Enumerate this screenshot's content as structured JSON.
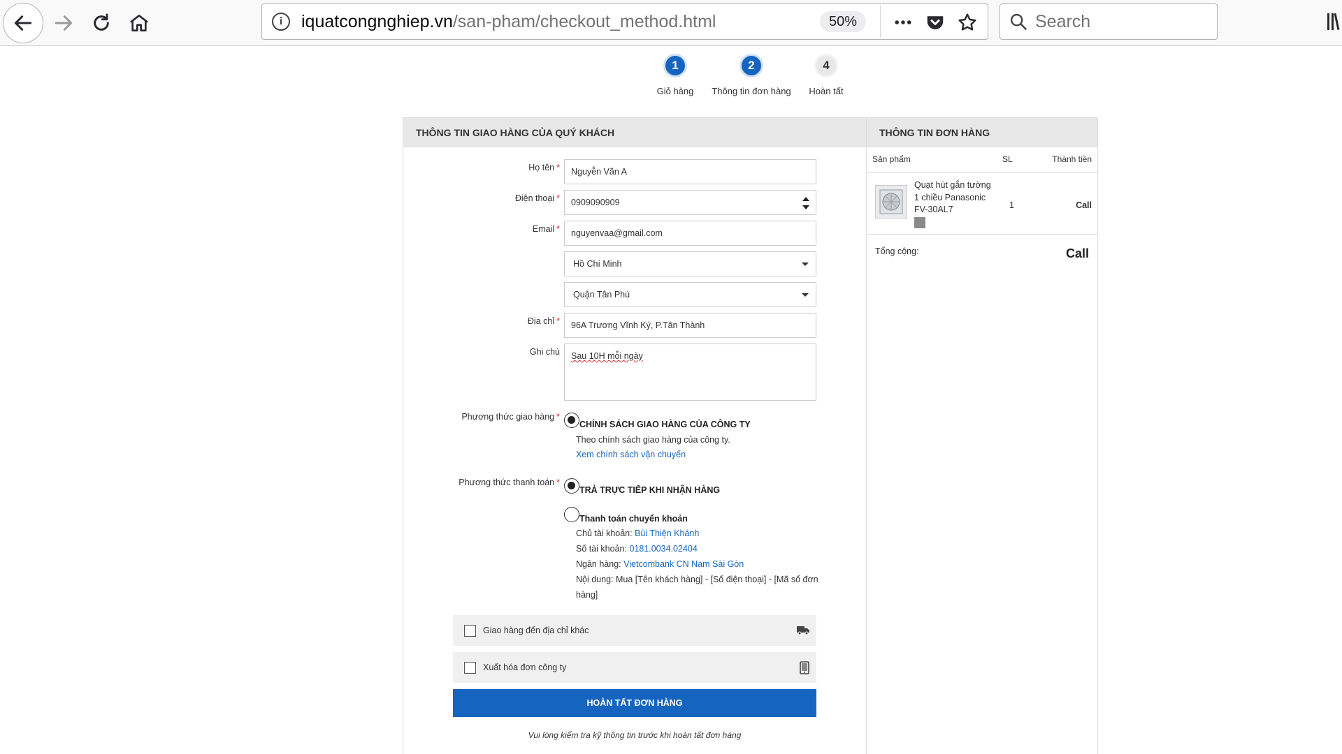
{
  "browser": {
    "url_domain": "iquatcongnghiep.vn",
    "url_path": "/san-pham/checkout_method.html",
    "zoom": "50%",
    "search_placeholder": "Search",
    "icons": [
      "back-arrow-icon",
      "forward-arrow-icon",
      "reload-icon",
      "home-icon",
      "info-icon",
      "more-icon",
      "pocket-icon",
      "star-icon",
      "search-icon",
      "library-icon"
    ]
  },
  "steps": [
    {
      "number": "1",
      "label": "Giỏ hàng",
      "active": true
    },
    {
      "number": "2",
      "label": "Thông tin đơn hàng",
      "active": true
    },
    {
      "number": "4",
      "label": "Hoàn tất",
      "active": false
    }
  ],
  "shipping": {
    "heading": "THÔNG TIN GIAO HÀNG CỦA QUÝ KHÁCH",
    "required_mark": "*",
    "name_label": "Họ tên",
    "name_value": "Nguyễn Văn A",
    "phone_label": "Điện thoại",
    "phone_value": "0909090909",
    "email_label": "Email",
    "email_value": "nguyenvaa@gmail.com",
    "city_value": "Hồ Chí Minh",
    "district_value": "Quận Tân Phú",
    "address_label": "Địa chỉ",
    "address_value": "96A Trương Vĩnh Ký, P.Tân Thành",
    "note_label": "Ghi chú",
    "note_value": "Sau 10H mỗi ngày",
    "delivery_label": "Phương thức giao hàng",
    "delivery_option_title": "CHÍNH SÁCH GIAO HÀNG CỦA CÔNG TY",
    "delivery_option_desc": "Theo chính sách giao hàng của công ty.",
    "delivery_option_link": "Xem chính sách vận chuyển",
    "payment_label": "Phương thức thanh toán",
    "payment_cod": "TRẢ TRỰC TIẾP KHI NHẬN HÀNG",
    "payment_transfer": "Thanh toán chuyển khoản",
    "account_holder_label": "Chủ tài khoản:",
    "account_holder": "Bùi Thiện Khánh",
    "account_number_label": "Số tài khoản:",
    "account_number": "0181.0034.02404",
    "bank_label": "Ngân hàng:",
    "bank": "Vietcombank CN Nam Sài Gòn",
    "transfer_content": "Nội dung: Mua [Tên khách hàng] - [Số điện thoại] - [Mã số đơn",
    "transfer_content_2": "hàng]",
    "ship_other_label": "Giao hàng đến địa chỉ khác",
    "invoice_label": "Xuất hóa đơn công ty",
    "submit_label": "HOÀN TẤT ĐƠN HÀNG",
    "footer_note": "Vui lòng kiểm tra kỹ thông tin trước khi hoàn tất đơn hàng"
  },
  "order": {
    "heading": "THÔNG TIN ĐƠN HÀNG",
    "col_product": "Sản phẩm",
    "col_qty": "SL",
    "col_total": "Thành tiền",
    "item_name_1": "Quạt hút gắn tường",
    "item_name_2": "1 chiều Panasonic",
    "item_name_3": "FV-30AL7",
    "item_qty": "1",
    "item_price": "Call",
    "total_label": "Tổng cộng:",
    "total_value": "Call"
  }
}
